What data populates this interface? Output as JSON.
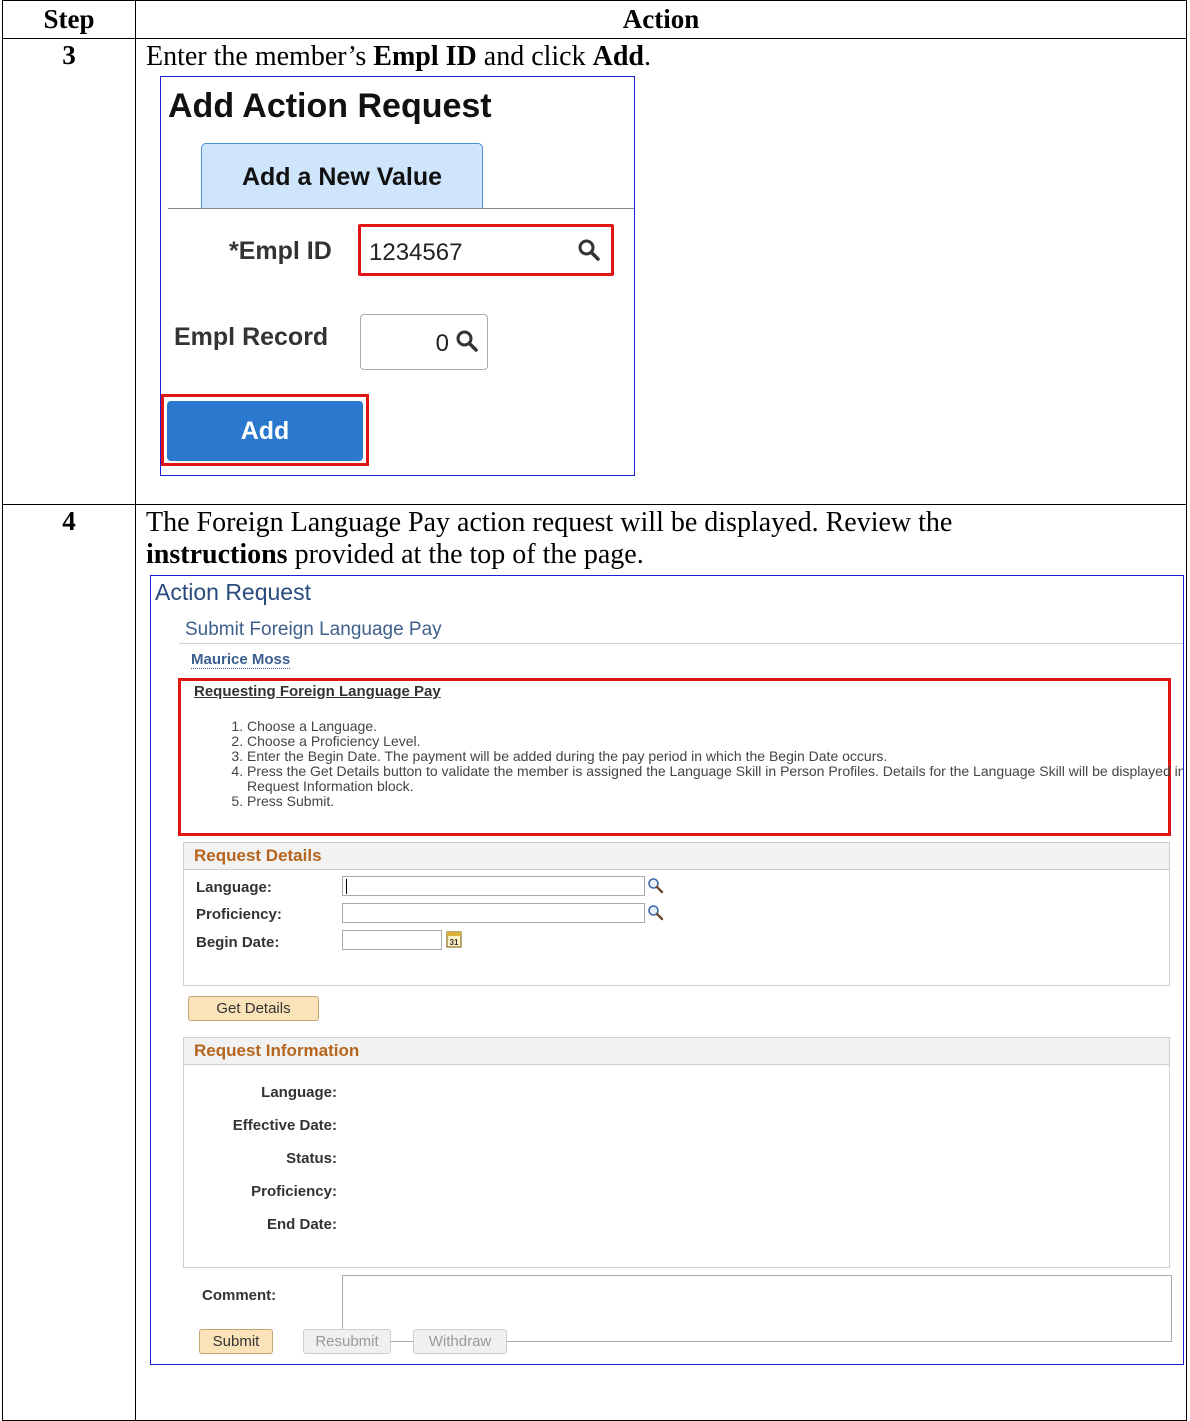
{
  "table": {
    "headers": {
      "step": "Step",
      "action": "Action"
    },
    "rows": [
      {
        "step": "3",
        "text_parts": [
          "Enter the member’s ",
          "Empl ID",
          " and click ",
          "Add",
          "."
        ]
      },
      {
        "step": "4",
        "text_line1": "The Foreign Language Pay action request will be displayed.  Review the",
        "text_bold": "instructions",
        "text_rest": " provided at the top of the page."
      }
    ]
  },
  "add_action_request": {
    "title": "Add Action Request",
    "tab_label": "Add a New Value",
    "empl_id_label": "*Empl ID",
    "empl_id_value": "1234567",
    "empl_record_label": "Empl Record",
    "empl_record_value": "0",
    "add_button": "Add",
    "icons": {
      "lookup": "search-icon"
    },
    "colors": {
      "highlight": "#e21515",
      "add_button": "#2b78cf",
      "tab": "#cfe5fb"
    }
  },
  "action_request": {
    "title": "Action Request",
    "subtitle": "Submit Foreign Language Pay",
    "member_name": "Maurice Moss",
    "instructions": {
      "heading": "Requesting Foreign Language Pay",
      "items": [
        "Choose a Language.",
        "Choose a Proficiency Level.",
        "Enter the Begin Date. The payment will be added during the pay period in which the Begin Date occurs.",
        "Press the Get Details button to validate the member is assigned the Language Skill in Person Profiles. Details for the Language Skill will be displayed in the Request Information block.",
        "Press Submit."
      ]
    },
    "request_details": {
      "heading": "Request Details",
      "language_label": "Language:",
      "proficiency_label": "Proficiency:",
      "begin_date_label": "Begin Date:"
    },
    "get_details_button": "Get Details",
    "request_information": {
      "heading": "Request Information",
      "language_label": "Language:",
      "effective_date_label": "Effective Date:",
      "status_label": "Status:",
      "proficiency_label": "Proficiency:",
      "end_date_label": "End Date:"
    },
    "comment_label": "Comment:",
    "buttons": {
      "submit": "Submit",
      "resubmit": "Resubmit",
      "withdraw": "Withdraw"
    },
    "icons": {
      "lookup": "search-icon",
      "calendar": "calendar-icon"
    },
    "colors": {
      "section_heading": "#b5651d",
      "title": "#2a4b7d",
      "primary_button": "#fbe3b9"
    }
  }
}
